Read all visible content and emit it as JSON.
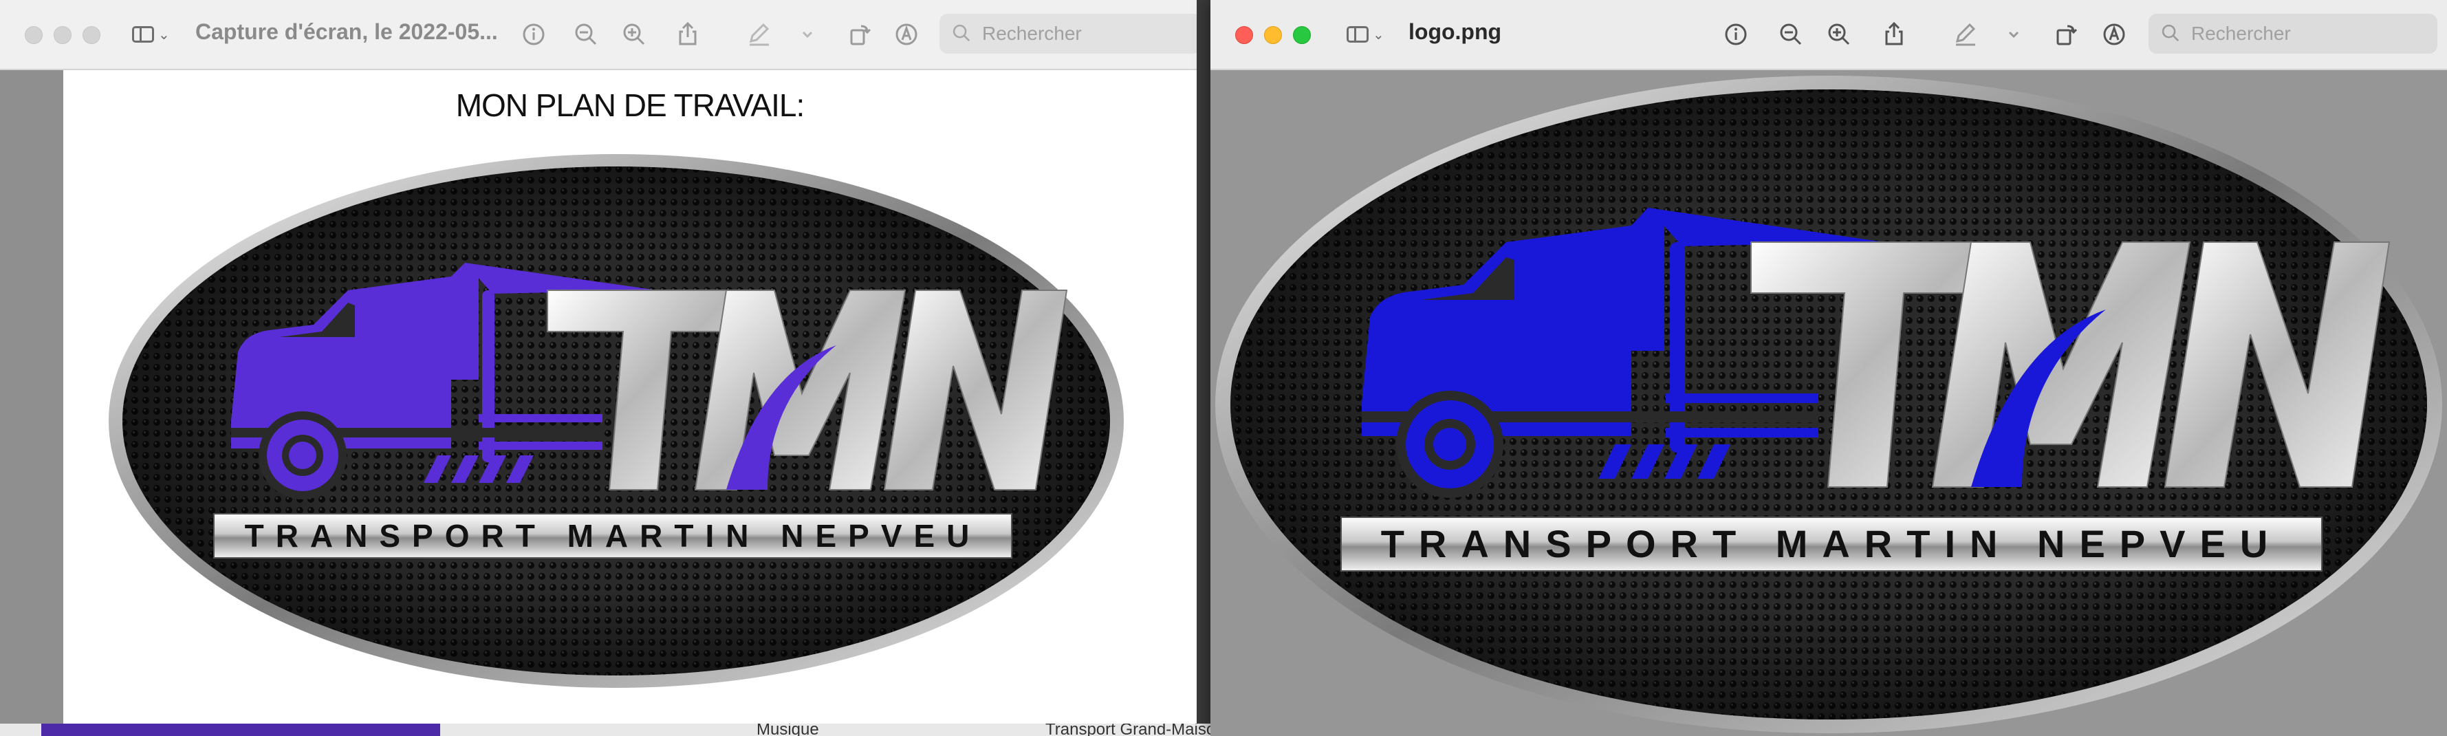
{
  "left_window": {
    "title": "Capture d'écran, le 2022-05...",
    "search_placeholder": "Rechercher",
    "document_heading": "MON PLAN DE TRAVAIL:"
  },
  "right_window": {
    "title": "logo.png",
    "search_placeholder": "Rechercher"
  },
  "logo": {
    "monogram": "TMN",
    "tagline": "TRANSPORT MARTIN NEPVEU"
  },
  "finder": {
    "item_music": "Musique",
    "item_folder": "Transport Grand-Maison"
  },
  "colors": {
    "truck_left": "#5a2ed6",
    "truck_right": "#1a18d8",
    "close": "#ff5f57",
    "minimize": "#febc2e",
    "zoom": "#28c840"
  },
  "toolbar_icons": [
    "sidebar-toggle-icon",
    "info-icon",
    "zoom-out-icon",
    "zoom-in-icon",
    "share-icon",
    "markup-pen-icon",
    "chevron-down-icon",
    "rotate-icon",
    "annotate-icon",
    "search-icon"
  ]
}
